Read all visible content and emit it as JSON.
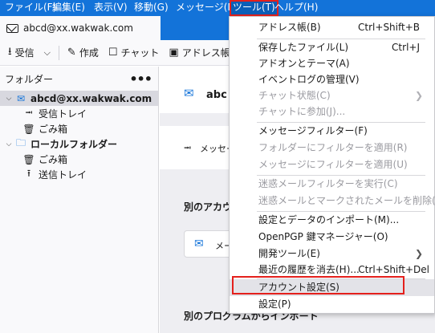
{
  "menubar": {
    "items": [
      "ファイル(F)",
      "編集(E)",
      "表示(V)",
      "移動(G)",
      "メッセージ(M)",
      "ツール(T)",
      "ヘルプ(H)"
    ]
  },
  "tab": {
    "title": "abcd@xx.wakwak.com"
  },
  "toolbar": {
    "get_mail": "受信",
    "write": "作成",
    "chat": "チャット",
    "address_book": "アドレス帳"
  },
  "folders": {
    "header": "フォルダー",
    "more": "•••",
    "account": "abcd@xx.wakwak.com",
    "inbox": "受信トレイ",
    "trash": "ごみ箱",
    "local": "ローカルフォルダー",
    "local_trash": "ごみ箱",
    "outbox": "送信トレイ"
  },
  "main": {
    "account_title": "abc",
    "messages_label": "メッセー",
    "other_accounts": "別のアカウ",
    "email_chip": "メー",
    "import_heading": "別のプログラムからインポート"
  },
  "tools_menu": {
    "items": [
      {
        "label": "アドレス帳(B)",
        "shortcut": "Ctrl+Shift+B"
      },
      {
        "label": "保存したファイル(L)",
        "shortcut": "Ctrl+J"
      },
      {
        "label": "アドオンとテーマ(A)"
      },
      {
        "label": "イベントログの管理(V)"
      },
      {
        "label": "チャット状態(C)",
        "disabled": true,
        "submenu": true
      },
      {
        "label": "チャットに参加(J)...",
        "disabled": true
      },
      {
        "label": "メッセージフィルター(F)"
      },
      {
        "label": "フォルダーにフィルターを適用(R)",
        "disabled": true
      },
      {
        "label": "メッセージにフィルターを適用(U)",
        "disabled": true
      },
      {
        "label": "迷惑メールフィルターを実行(C)",
        "disabled": true
      },
      {
        "label": "迷惑メールとマークされたメールを削除(D)",
        "disabled": true
      },
      {
        "label": "設定とデータのインポート(M)..."
      },
      {
        "label": "OpenPGP 鍵マネージャー(O)"
      },
      {
        "label": "開発ツール(E)",
        "submenu": true
      },
      {
        "label": "最近の履歴を消去(H)...",
        "shortcut": "Ctrl+Shift+Del"
      },
      {
        "label": "アカウント設定(S)",
        "highlighted": true
      },
      {
        "label": "設定(P)"
      }
    ]
  },
  "colors": {
    "brand_blue": "#1373d9",
    "annotation_red": "#e4201c"
  }
}
